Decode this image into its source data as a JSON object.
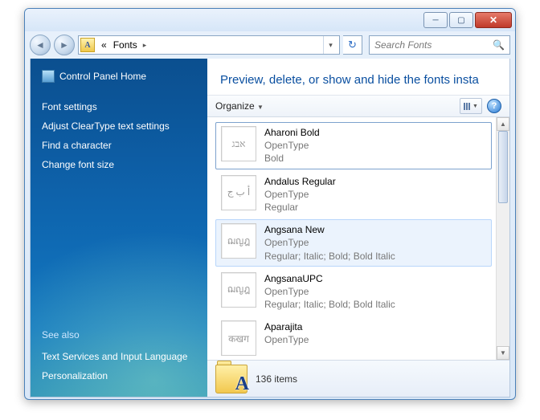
{
  "breadcrumb": {
    "sep": "«",
    "current": "Fonts",
    "arrow": "▸"
  },
  "search": {
    "placeholder": "Search Fonts"
  },
  "sidebar": {
    "home": "Control Panel Home",
    "links": [
      "Font settings",
      "Adjust ClearType text settings",
      "Find a character",
      "Change font size"
    ],
    "seealso_label": "See also",
    "seealso": [
      "Text Services and Input Language",
      "Personalization"
    ]
  },
  "main": {
    "heading": "Preview, delete, or show and hide the fonts insta",
    "organize": "Organize"
  },
  "fonts": [
    {
      "name": "Aharoni Bold",
      "type": "OpenType",
      "style": "Bold",
      "sample": "אבג",
      "stack": false,
      "state": "selected"
    },
    {
      "name": "Andalus Regular",
      "type": "OpenType",
      "style": "Regular",
      "sample": "أ ب ج",
      "stack": false,
      "state": ""
    },
    {
      "name": "Angsana New",
      "type": "OpenType",
      "style": "Regular; Italic; Bold; Bold Italic",
      "sample": "ฌญฎ",
      "stack": true,
      "state": "hover"
    },
    {
      "name": "AngsanaUPC",
      "type": "OpenType",
      "style": "Regular; Italic; Bold; Bold Italic",
      "sample": "ฌญฎ",
      "stack": true,
      "state": ""
    },
    {
      "name": "Aparajita",
      "type": "OpenType",
      "style": "",
      "sample": "कखग",
      "stack": true,
      "state": ""
    }
  ],
  "status": {
    "count": "136 items"
  }
}
